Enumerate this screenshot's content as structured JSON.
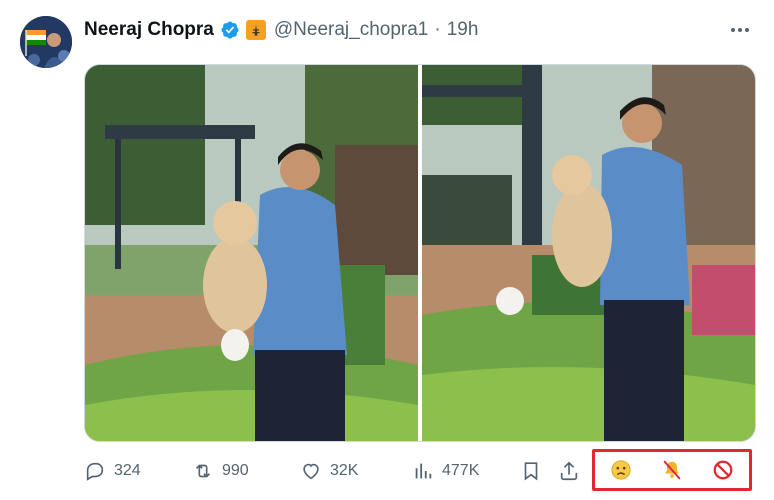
{
  "author": {
    "name": "Neeraj Chopra",
    "handle": "@Neeraj_chopra1",
    "separator": "·",
    "time": "19h",
    "verified_color": "#1d9bf0"
  },
  "media": {
    "count": 2
  },
  "actions": {
    "replies": "324",
    "retweets": "990",
    "likes": "32K",
    "views": "477K"
  },
  "highlight": {
    "border_color": "#e0282e",
    "icons": [
      "sad-face-icon",
      "mute-bell-icon",
      "block-icon"
    ]
  }
}
